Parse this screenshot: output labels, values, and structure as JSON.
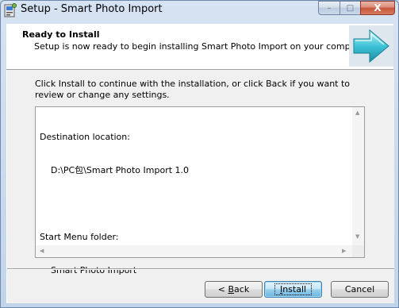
{
  "window": {
    "title": "Setup - Smart Photo Import"
  },
  "titlebar": {
    "minimize_glyph": "–",
    "maximize_glyph": "□",
    "close_glyph": "X"
  },
  "header": {
    "title": "Ready to Install",
    "subtitle": "Setup is now ready to begin installing Smart Photo Import on your computer."
  },
  "body": {
    "intro": "Click Install to continue with the installation, or click Back if you want to review or change any settings.",
    "summary_lines": [
      "Destination location:",
      "    D:\\PC包\\Smart Photo Import 1.0",
      "",
      "Start Menu folder:",
      "    Smart Photo Import"
    ]
  },
  "buttons": {
    "back_prefix": "< ",
    "back_key": "B",
    "back_rest": "ack",
    "install_key": "I",
    "install_rest": "nstall",
    "cancel": "Cancel"
  },
  "colors": {
    "accent": "#3c7fb1",
    "header_arrow": "#3ec4d6"
  }
}
